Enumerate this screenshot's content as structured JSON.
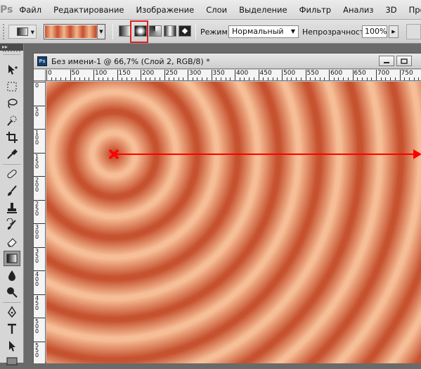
{
  "menubar": {
    "logo": "Ps",
    "items": [
      "Файл",
      "Редактирование",
      "Изображение",
      "Слои",
      "Выделение",
      "Фильтр",
      "Анализ",
      "3D",
      "Прос"
    ]
  },
  "options": {
    "mode_label": "Режим:",
    "mode_value": "Нормальный",
    "opacity_label": "Непрозрачность:",
    "opacity_value": "100%",
    "gradient_types": [
      "linear",
      "radial",
      "angle",
      "reflected",
      "diamond"
    ],
    "selected_gradient_type": "radial"
  },
  "document": {
    "title": "Без имени-1 @ 66,7% (Слой 2, RGB/8) *",
    "ps_badge": "Ps",
    "ruler_h_labels": [
      "0",
      "50",
      "100",
      "150",
      "200",
      "250",
      "300",
      "350",
      "400",
      "450",
      "500",
      "550",
      "600",
      "650",
      "700",
      "750"
    ],
    "ruler_v_labels": [
      "0",
      "50",
      "100",
      "150",
      "200",
      "250",
      "300",
      "350",
      "400",
      "450",
      "500",
      "550"
    ]
  },
  "toolbox": {
    "tools": [
      "move-tool",
      "marquee-tool",
      "lasso-tool",
      "quick-selection-tool",
      "crop-tool",
      "eyedropper-tool",
      "healing-brush-tool",
      "brush-tool",
      "clone-stamp-tool",
      "history-brush-tool",
      "eraser-tool",
      "gradient-tool",
      "blur-tool",
      "dodge-tool",
      "pen-tool",
      "type-tool",
      "path-selection-tool",
      "rectangle-tool"
    ],
    "active_tool": "gradient-tool"
  },
  "colors": {
    "gradient_dark": "#c65230",
    "gradient_light": "#f6be96",
    "guide_line": "#ff0000",
    "selection_highlight": "#e02020"
  }
}
